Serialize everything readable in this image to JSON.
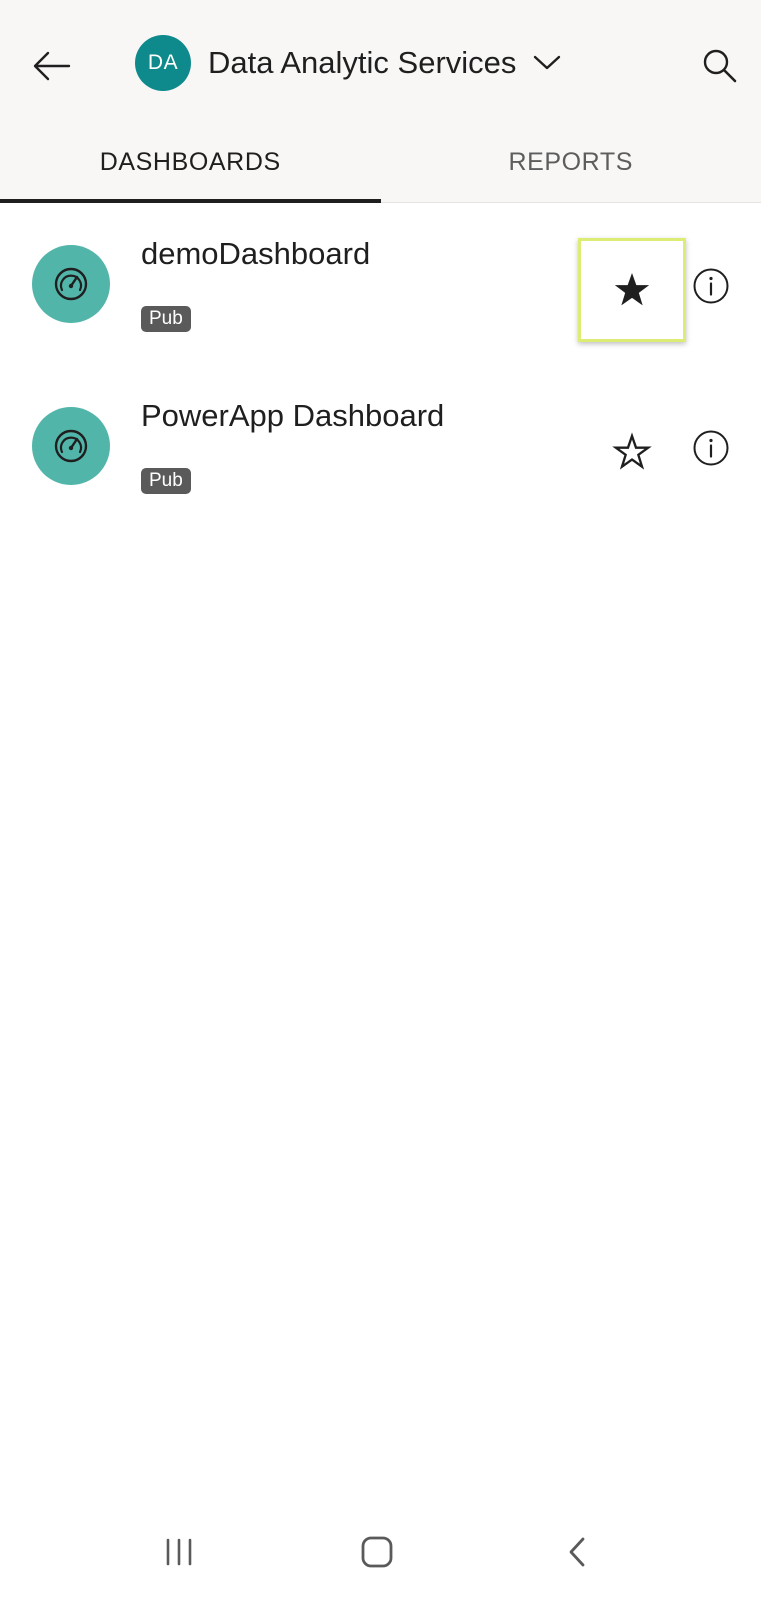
{
  "header": {
    "workspace_initials": "DA",
    "workspace_name": "Data Analytic Services",
    "workspace_avatar_color": "#0f8a8c"
  },
  "tabs": [
    {
      "label": "DASHBOARDS",
      "active": true
    },
    {
      "label": "REPORTS",
      "active": false
    }
  ],
  "items": [
    {
      "title": "demoDashboard",
      "badge": "Pub",
      "icon": "dashboard-gauge-icon",
      "favorite": true,
      "favorite_highlighted": true
    },
    {
      "title": "PowerApp Dashboard",
      "badge": "Pub",
      "icon": "dashboard-gauge-icon",
      "favorite": false,
      "favorite_highlighted": false
    }
  ],
  "icons": {
    "back": "arrow-left-icon",
    "dropdown": "chevron-down-icon",
    "search": "search-icon",
    "favorite_filled": "star-filled-icon",
    "favorite_outline": "star-outline-icon",
    "info": "info-icon",
    "nav_recents": "recent-apps-icon",
    "nav_home": "home-icon",
    "nav_back": "nav-back-icon"
  },
  "colors": {
    "item_icon_bg": "#52b5a9",
    "highlight_border": "#dcec74",
    "header_bg": "#f8f7f6"
  }
}
